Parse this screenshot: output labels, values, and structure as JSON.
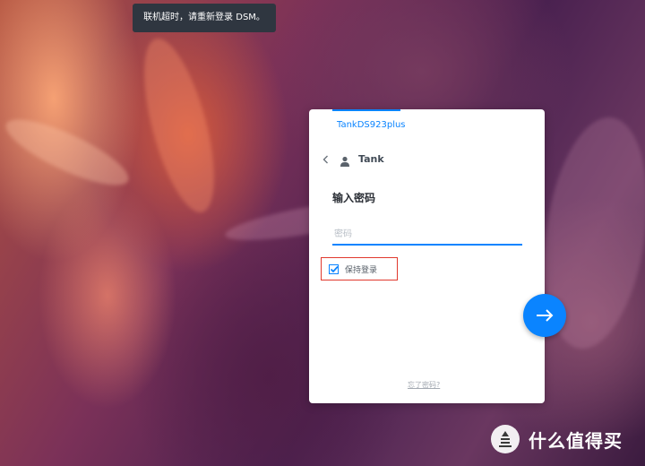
{
  "toast": {
    "message": "联机超时，请重新登录 DSM。"
  },
  "login": {
    "hostname": "TankDS923plus",
    "username": "Tank",
    "prompt": "输入密码",
    "password_placeholder": "密码",
    "password_value": "",
    "remember_label": "保持登录",
    "remember_checked": true,
    "forgot_label": "忘了密码?"
  },
  "icons": {
    "back": "chevron-left-icon",
    "user": "user-icon",
    "submit": "arrow-right-icon",
    "checkbox": "checkmark-icon"
  },
  "colors": {
    "accent": "#0a84ff",
    "highlight_border": "#e0392e",
    "toast_bg": "#2f3640"
  },
  "watermark": {
    "text": "什么值得买",
    "logo_glyph": "值"
  }
}
